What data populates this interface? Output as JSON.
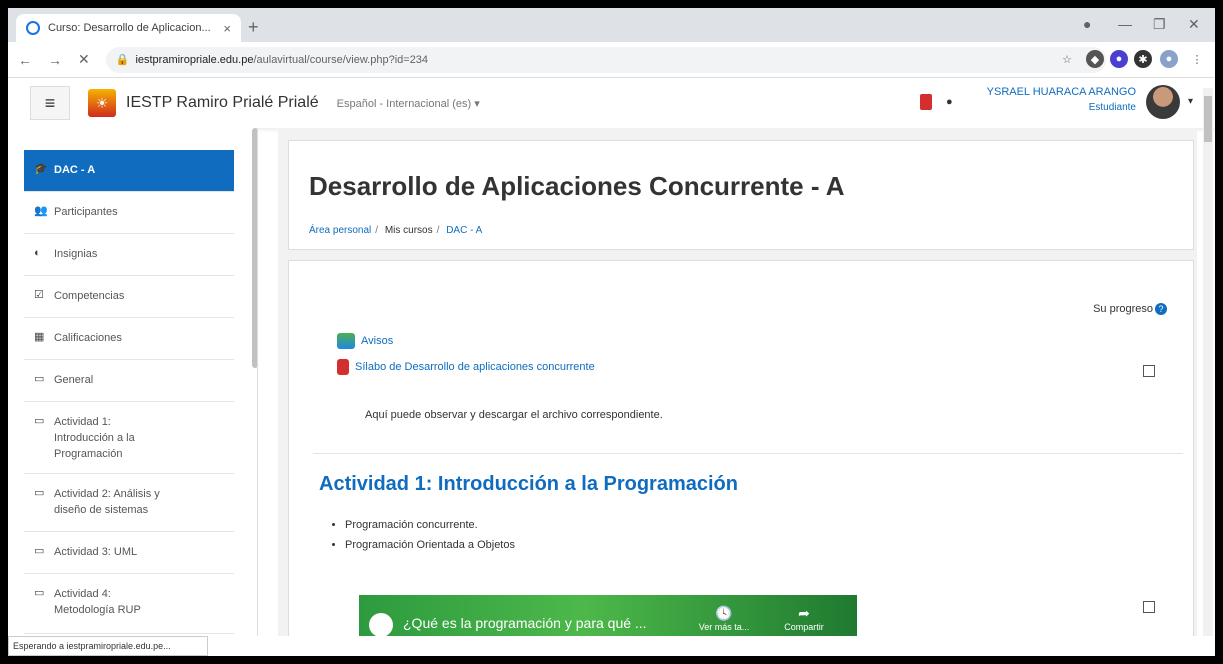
{
  "browser": {
    "tab_title": "Curso: Desarrollo de Aplicacion...",
    "tab_close": "×",
    "new_tab": "+",
    "url_host": "iestpramiropriale.edu.pe",
    "url_path": "/aulavirtual/course/view.php?id=234",
    "status_text": "Esperando a iestpramiropriale.edu.pe..."
  },
  "header": {
    "menu_icon": "≡",
    "site_name": "IESTP Ramiro Prialé Prialé",
    "language": "Español - Internacional (es) ▾",
    "user_name": "YSRAEL HUARACA ARANGO",
    "user_role": "Estudiante"
  },
  "sidebar": {
    "items": [
      {
        "icon": "graduation-cap-icon",
        "label": "DAC - A"
      },
      {
        "icon": "users-icon",
        "label": "Participantes"
      },
      {
        "icon": "badge-icon",
        "label": "Insignias"
      },
      {
        "icon": "checkbox-icon",
        "label": "Competencias"
      },
      {
        "icon": "table-icon",
        "label": "Calificaciones"
      },
      {
        "icon": "folder-icon",
        "label": "General"
      },
      {
        "icon": "folder-icon",
        "label": "Actividad 1: Introducción a la Programación"
      },
      {
        "icon": "folder-icon",
        "label": "Actividad 2: Análisis y diseño de sistemas"
      },
      {
        "icon": "folder-icon",
        "label": "Actividad 3: UML"
      },
      {
        "icon": "folder-icon",
        "label": "Actividad 4: Metodología RUP"
      }
    ]
  },
  "course": {
    "title": "Desarrollo de Aplicaciones Concurrente - A",
    "breadcrumb": [
      "Área personal",
      "Mis cursos",
      "DAC - A"
    ],
    "progress_label": "Su progreso",
    "activities": [
      {
        "label": "Avisos"
      },
      {
        "label": "Sílabo de Desarrollo de aplicaciones concurrente"
      }
    ],
    "summary": "Aquí puede observar y descargar el archivo correspondiente.",
    "section_title": "Actividad 1: Introducción a la Programación",
    "bullets": [
      "Programación concurrente.",
      "Programación Orientada a Objetos"
    ],
    "video": {
      "title": "¿Qué es la programación y para qué ...",
      "watch_later": "Ver más ta...",
      "share": "Compartir"
    }
  }
}
